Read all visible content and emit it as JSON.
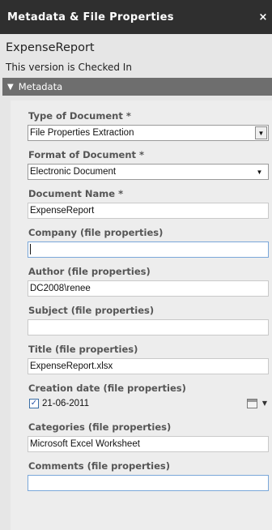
{
  "header": {
    "title": "Metadata & File Properties",
    "close_icon": "close-icon",
    "close_glyph": "×"
  },
  "document": {
    "name": "ExpenseReport",
    "status": "This version is Checked In"
  },
  "section": {
    "expand_glyph": "▼",
    "label": "Metadata"
  },
  "fields": {
    "type_of_document": {
      "label": "Type of Document *",
      "value": "File Properties Extraction",
      "arrow": "▼"
    },
    "format_of_document": {
      "label": "Format of Document *",
      "value": "Electronic Document",
      "arrow": "▼"
    },
    "document_name": {
      "label": "Document Name *",
      "value": "ExpenseReport"
    },
    "company": {
      "label": "Company (file properties)",
      "value": ""
    },
    "author": {
      "label": "Author (file properties)",
      "value": "DC2008\\renee"
    },
    "subject": {
      "label": "Subject (file properties)",
      "value": ""
    },
    "title": {
      "label": "Title (file properties)",
      "value": "ExpenseReport.xlsx"
    },
    "creation_date": {
      "label": "Creation date (file properties)",
      "value": "21-06-2011",
      "checked": "✓",
      "arrow": "▼"
    },
    "categories": {
      "label": "Categories (file properties)",
      "value": "Microsoft Excel Worksheet"
    },
    "comments": {
      "label": "Comments (file properties)",
      "value": ""
    }
  },
  "colors": {
    "titlebar_bg": "#2f2f2f",
    "section_bg": "#6e6e6e",
    "panel_bg": "#e6e6e6",
    "label_color": "#555555",
    "focus_border": "#7aa7d9"
  }
}
